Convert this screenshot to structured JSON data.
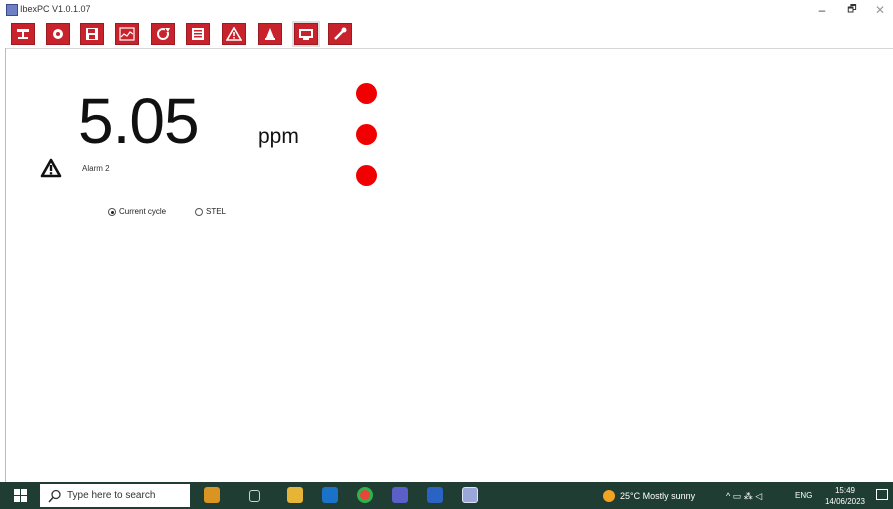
{
  "window": {
    "title": "IbexPC V1.0.1.07",
    "controls": {
      "minimize": "–",
      "maximize": "🗗",
      "close": "✕"
    }
  },
  "toolbar": {
    "buttons": [
      {
        "name": "network-icon"
      },
      {
        "name": "gear-icon"
      },
      {
        "name": "save-icon"
      },
      {
        "name": "chart-icon"
      },
      {
        "name": "refresh-icon"
      },
      {
        "name": "list-icon"
      },
      {
        "name": "warning-icon"
      },
      {
        "name": "bell-icon"
      },
      {
        "name": "display-icon",
        "active": true
      },
      {
        "name": "wrench-icon"
      }
    ]
  },
  "reading": {
    "value": "5.05",
    "unit": "ppm",
    "alarm_label": "Alarm 2",
    "indicator_color": "#f00000",
    "indicators": 3
  },
  "mode": {
    "options": [
      {
        "label": "Current cycle",
        "selected": true
      },
      {
        "label": "STEL",
        "selected": false
      }
    ]
  },
  "taskbar": {
    "search_placeholder": "Type here to search",
    "weather": "25°C  Mostly sunny",
    "tray_text": "^  ▭  ⁂  ◁",
    "language": "ENG",
    "time": "15:49",
    "date": "14/06/2023"
  }
}
